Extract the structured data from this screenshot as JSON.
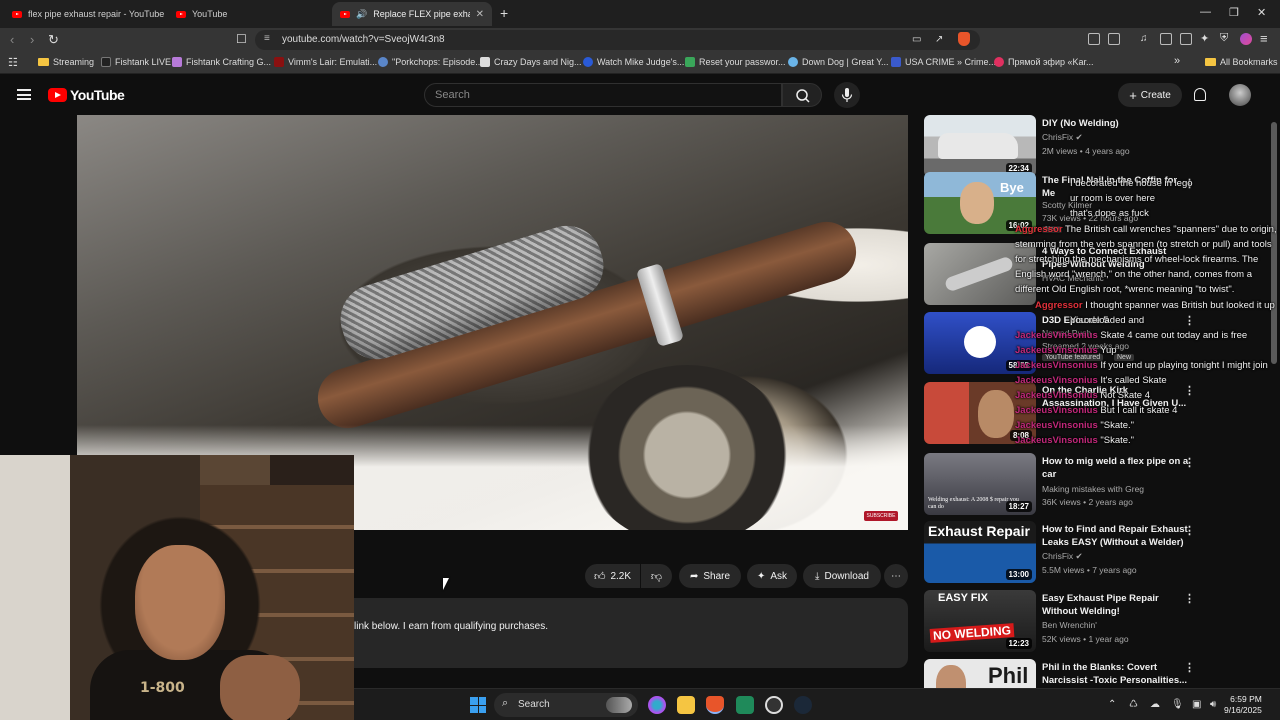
{
  "browser": {
    "tabs": [
      {
        "label": "flex pipe exhaust repair - YouTube",
        "active": false
      },
      {
        "label": "YouTube",
        "active": false
      },
      {
        "label": "Replace FLEX pipe exhaust pi",
        "active": true
      }
    ],
    "new_tab": "+",
    "url": "youtube.com/watch?v=SveojW4r3n8",
    "bookmarks": [
      "Streaming",
      "Fishtank LIVE",
      "Fishtank Crafting G...",
      "Vimm's Lair: Emulati...",
      "\"Porkchops: Episode...",
      "Crazy Days and Nig...",
      "Watch Mike Judge's...",
      "Reset your passwor...",
      "Down Dog | Great Y...",
      "USA CRIME » Crime...",
      "Прямой эфир «Kar..."
    ],
    "all_bookmarks": "All Bookmarks"
  },
  "youtube": {
    "logo_text": "YouTube",
    "search_placeholder": "Search",
    "create_label": "Create"
  },
  "video": {
    "watermark": "SUBSCRIBE",
    "shirt_print": "1-800"
  },
  "actions": {
    "likes": "2.2K",
    "share": "Share",
    "ask": "Ask",
    "download": "Download"
  },
  "description": {
    "text": "link below.  I earn from qualifying purchases."
  },
  "recommendations": [
    {
      "title": "DIY (No Welding)",
      "channel": "ChrisFix",
      "meta": "2M views • 4 years ago",
      "duration": "22:34",
      "thumb_color": "#c9c9c9"
    },
    {
      "title": "The Final Nail in the Coffin for Me",
      "channel": "Scotty Kilmer",
      "meta": "73K views • 22 hours ago",
      "duration": "16:02",
      "badge": "New",
      "thumb_color": "#4a7a3a"
    },
    {
      "title": "4 Ways to Connect Exhaust Pipes Without Welding",
      "channel": "HVAC Mechanic",
      "meta": "",
      "duration": "",
      "thumb_color": "#8a8a86"
    },
    {
      "title": "D3D Episode 5",
      "channel": "Nomad Push",
      "meta": "Streamed 2 weeks ago",
      "duration": "58:55",
      "badge": "YouTube featured",
      "badge2": "New",
      "thumb_color": "#223a9a"
    },
    {
      "title": "On the Charlie Kirk Assassination, I Have Given U...",
      "channel": "",
      "meta": "",
      "duration": "8:08",
      "thumb_color": "#7a3a2a"
    },
    {
      "title": "How to mig weld a flex pipe on a car",
      "channel": "Making mistakes with Greg",
      "meta": "36K views • 2 years ago",
      "duration": "18:27",
      "thumb_color": "#6a6a72",
      "thumb_caption": "Welding exhaust: A 2008 $ repair you can do"
    },
    {
      "title": "How to Find and Repair Exhaust Leaks EASY (Without a Welder)",
      "channel": "ChrisFix",
      "meta": "5.5M views • 7 years ago",
      "duration": "13:00",
      "thumb_text": "Exhaust Repair",
      "thumb_color": "#1a5aa8"
    },
    {
      "title": "Easy Exhaust Pipe Repair Without Welding!",
      "channel": "Ben Wrenchin'",
      "meta": "52K views • 1 year ago",
      "duration": "12:23",
      "thumb_text": "EASY FIX",
      "thumb_text2": "NO WELDING",
      "thumb_color": "#2a2a2a"
    },
    {
      "title": "Phil in the Blanks: Covert Narcissist -Toxic Personalities...",
      "channel": "",
      "meta": "",
      "duration": "",
      "thumb_text": "Phil",
      "thumb_color": "#e8e8e8"
    }
  ],
  "chat": [
    {
      "user": "",
      "text": "I decorated the house in lego"
    },
    {
      "user": "",
      "text": "ur room is over here"
    },
    {
      "user": "",
      "text": "that's dope as fuck"
    },
    {
      "user": "Aggressor",
      "text": "The British call wrenches \"spanners\" due to origin, stemming from the verb spannen (to stretch or pull) and tools for stretching the mechanisms of wheel-lock firearms. The English word \"wrench,\" on the other hand, comes from a different Old English root, *wrenc meaning \"to twist\"."
    },
    {
      "user": "Aggressor",
      "text": "I thought spanner was British but looked it up"
    },
    {
      "user": "",
      "text": "You reloaded and"
    },
    {
      "user": "JackeusVinsonius",
      "text": "Skate 4 came out today and is free"
    },
    {
      "user": "JackeusVinsonius",
      "text": "Yup"
    },
    {
      "user": "JackeusVinsonius",
      "text": "If you end up playing tonight I might join"
    },
    {
      "user": "JackeusVinsonius",
      "text": "It's called Skate"
    },
    {
      "user": "JackeusVinsonius",
      "text": "Not Skate 4"
    },
    {
      "user": "JackeusVinsonius",
      "text": "But I call it skate 4"
    },
    {
      "user": "JackeusVinsonius",
      "text": "\"Skate.\""
    },
    {
      "user": "JackeusVinsonius",
      "text": "\"Skate.\""
    }
  ],
  "taskbar": {
    "search": "Search",
    "time": "6:59 PM",
    "date": "9/16/2025"
  },
  "colors": {
    "youtube_red": "#ff0000",
    "background": "#0f0f0f",
    "chat_username": "#c1287a"
  }
}
